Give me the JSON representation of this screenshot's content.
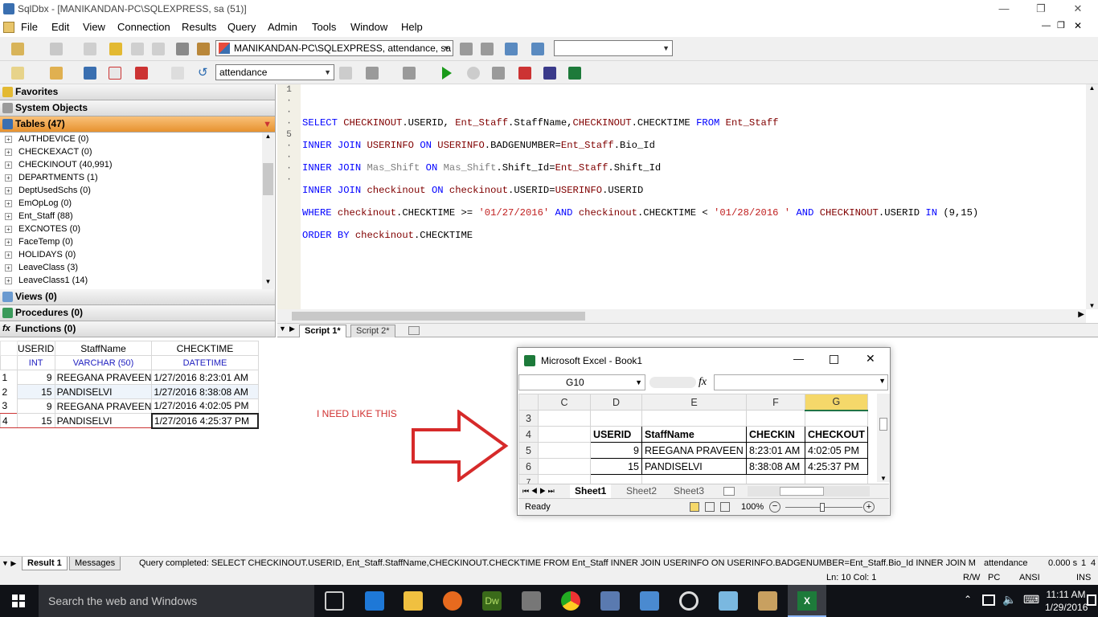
{
  "window": {
    "title": "SqlDbx - [MANIKANDAN-PC\\SQLEXPRESS, sa (51)]",
    "minimize": "—",
    "restore": "❐",
    "close": "✕"
  },
  "menu": [
    "File",
    "Edit",
    "View",
    "Connection",
    "Results",
    "Query",
    "Admin",
    "Tools",
    "Window",
    "Help"
  ],
  "toolbar": {
    "connection": "MANIKANDAN-PC\\SQLEXPRESS, attendance, sa",
    "database": "attendance",
    "empty_combo": ""
  },
  "left_panel": {
    "favorites": "Favorites",
    "system_objects": "System Objects",
    "tables": "Tables (47)",
    "tree": [
      "AUTHDEVICE (0)",
      "CHECKEXACT (0)",
      "CHECKINOUT (40,991)",
      "DEPARTMENTS (1)",
      "DeptUsedSchs (0)",
      "EmOpLog (0)",
      "Ent_Staff (88)",
      "EXCNOTES (0)",
      "FaceTemp (0)",
      "HOLIDAYS (0)",
      "LeaveClass (3)",
      "LeaveClass1 (14)"
    ],
    "views": "Views (0)",
    "procedures": "Procedures (0)",
    "functions": "Functions (0)"
  },
  "editor": {
    "gutter": [
      "1",
      "·",
      "·",
      "·",
      "5",
      "·",
      "·",
      "·",
      "·"
    ],
    "tabs": [
      "Script 1*",
      "Script 2*"
    ]
  },
  "results": {
    "columns": [
      {
        "name": "USERID",
        "type": "INT"
      },
      {
        "name": "StaffName",
        "type": "VARCHAR (50)"
      },
      {
        "name": "CHECKTIME",
        "type": "DATETIME"
      }
    ],
    "rows": [
      [
        "1",
        "9",
        "REEGANA PRAVEEN",
        "1/27/2016 8:23:01 AM"
      ],
      [
        "2",
        "15",
        "PANDISELVI",
        "1/27/2016 8:38:08 AM"
      ],
      [
        "3",
        "9",
        "REEGANA PRAVEEN",
        "1/27/2016 4:02:05 PM"
      ],
      [
        "4",
        "15",
        "PANDISELVI",
        "1/27/2016 4:25:37 PM"
      ]
    ]
  },
  "annotation": "I NEED LIKE THIS",
  "excel": {
    "title": "Microsoft Excel - Book1",
    "name_box": "G10",
    "fx": "fx",
    "col_headers": [
      "C",
      "D",
      "E",
      "F",
      "G"
    ],
    "row_headers": [
      "3",
      "4",
      "5",
      "6",
      "7"
    ],
    "header_row": [
      "USERID",
      "StaffName",
      "CHECKIN",
      "CHECKOUT"
    ],
    "rows": [
      [
        "9",
        "REEGANA PRAVEEN",
        "8:23:01 AM",
        "4:02:05 PM"
      ],
      [
        "15",
        "PANDISELVI",
        "8:38:08 AM",
        "4:25:37 PM"
      ]
    ],
    "sheets": [
      "Sheet1",
      "Sheet2",
      "Sheet3"
    ],
    "status": "Ready",
    "zoom": "100%"
  },
  "status": {
    "result_tab": "Result 1",
    "messages_tab": "Messages",
    "message": "Query completed: SELECT CHECKINOUT.USERID, Ent_Staff.StaffName,CHECKINOUT.CHECKTIME FROM Ent_Staff INNER JOIN USERINFO ON USERINFO.BADGENUMBER=Ent_Staff.Bio_Id  INNER JOIN Mas_Shift ...",
    "db": "attendance",
    "time": "0.000 s",
    "rows": "1",
    "cols": "4",
    "position": "Ln: 10  Col: 1",
    "rw": "R/W",
    "pc": "PC",
    "ansi": "ANSI",
    "ins": "INS"
  },
  "taskbar": {
    "search": "Search the web and Windows",
    "time": "11:11 AM",
    "date": "1/29/2016"
  }
}
